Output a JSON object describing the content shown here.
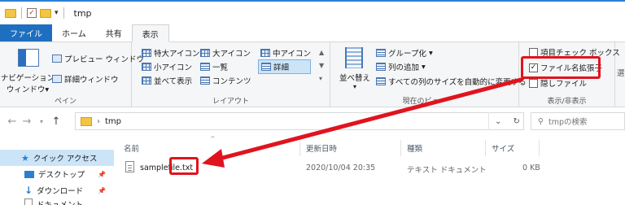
{
  "window": {
    "title": "tmp"
  },
  "tabs": [
    {
      "label": "ファイル"
    },
    {
      "label": "ホーム"
    },
    {
      "label": "共有"
    },
    {
      "label": "表示"
    }
  ],
  "ribbon": {
    "panes_group": {
      "label": "ペイン",
      "nav_pane_line1": "ナビゲーション",
      "nav_pane_line2": "ウィンドウ",
      "preview": "プレビュー ウィンドウ",
      "details": "詳細ウィンドウ"
    },
    "layout_group": {
      "label": "レイアウト",
      "items": [
        "特大アイコン",
        "大アイコン",
        "中アイコン",
        "小アイコン",
        "一覧",
        "詳細",
        "並べて表示",
        "コンテンツ"
      ]
    },
    "current_view_group": {
      "label": "現在のビュー",
      "sort": "並べ替え",
      "group_by": "グループ化",
      "add_columns": "列の追加",
      "autofit": "すべての列のサイズを自動的に変更する"
    },
    "show_hide_group": {
      "label": "表示/非表示",
      "item_checkboxes": "項目チェック ボックス",
      "file_extensions": "ファイル名拡張子",
      "hidden_items": "隠しファイル",
      "more": "選"
    }
  },
  "address": {
    "path": "tmp",
    "search_placeholder": "tmpの検索"
  },
  "sidebar": {
    "items": [
      {
        "label": "クイック アクセス"
      },
      {
        "label": "デスクトップ"
      },
      {
        "label": "ダウンロード"
      },
      {
        "label": "ドキュメント"
      }
    ]
  },
  "file_list": {
    "columns": [
      "名前",
      "更新日時",
      "種類",
      "サイズ"
    ],
    "rows": [
      {
        "name_base": "samplefile",
        "name_ext": ".txt",
        "modified": "2020/10/04 20:35",
        "type": "テキスト ドキュメント",
        "size": "0 KB"
      }
    ]
  },
  "colors": {
    "accent": "#1f6fc0",
    "highlight": "#e0141e"
  }
}
